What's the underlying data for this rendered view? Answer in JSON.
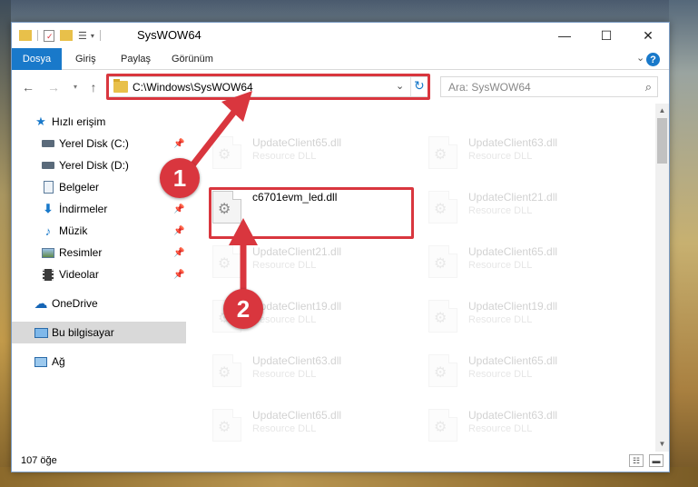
{
  "window": {
    "title": "SysWOW64",
    "controls": {
      "minimize": "—",
      "maximize": "☐",
      "close": "✕"
    }
  },
  "ribbon": {
    "tabs": [
      "Dosya",
      "Giriş",
      "Paylaş",
      "Görünüm"
    ],
    "help": "?"
  },
  "navigation": {
    "address": "C:\\Windows\\SysWOW64",
    "search_placeholder": "Ara: SysWOW64"
  },
  "sidebar": {
    "items": [
      {
        "label": "Hızlı erişim",
        "icon": "star-icon",
        "pinned": false
      },
      {
        "label": "Yerel Disk (C:)",
        "icon": "drive-icon",
        "pinned": true
      },
      {
        "label": "Yerel Disk (D:)",
        "icon": "drive-icon",
        "pinned": false
      },
      {
        "label": "Belgeler",
        "icon": "documents-icon",
        "pinned": true
      },
      {
        "label": "İndirmeler",
        "icon": "download-icon",
        "pinned": true
      },
      {
        "label": "Müzik",
        "icon": "music-icon",
        "pinned": true
      },
      {
        "label": "Resimler",
        "icon": "pictures-icon",
        "pinned": true
      },
      {
        "label": "Videolar",
        "icon": "videos-icon",
        "pinned": true
      },
      {
        "label": "OneDrive",
        "icon": "cloud-icon",
        "pinned": false
      },
      {
        "label": "Bu bilgisayar",
        "icon": "computer-icon",
        "pinned": false,
        "selected": true
      },
      {
        "label": "Ağ",
        "icon": "network-icon",
        "pinned": false
      }
    ]
  },
  "files": {
    "left_column": [
      {
        "name": "UpdateClient65.dll",
        "type": "Resource DLL"
      },
      {
        "name": "c6701evm_led.dll",
        "type": "",
        "highlighted": true
      },
      {
        "name": "UpdateClient21.dll",
        "type": "Resource DLL"
      },
      {
        "name": "UpdateClient19.dll",
        "type": "Resource DLL"
      },
      {
        "name": "UpdateClient63.dll",
        "type": "Resource DLL"
      },
      {
        "name": "UpdateClient65.dll",
        "type": "Resource DLL"
      }
    ],
    "right_column": [
      {
        "name": "UpdateClient63.dll",
        "type": "Resource DLL"
      },
      {
        "name": "UpdateClient21.dll",
        "type": "Resource DLL"
      },
      {
        "name": "UpdateClient65.dll",
        "type": "Resource DLL"
      },
      {
        "name": "UpdateClient19.dll",
        "type": "Resource DLL"
      },
      {
        "name": "UpdateClient65.dll",
        "type": "Resource DLL"
      },
      {
        "name": "UpdateClient63.dll",
        "type": "Resource DLL"
      }
    ]
  },
  "status": {
    "item_count": "107 öğe"
  },
  "annotations": {
    "step1": "1",
    "step2": "2",
    "color": "#d9363e"
  }
}
